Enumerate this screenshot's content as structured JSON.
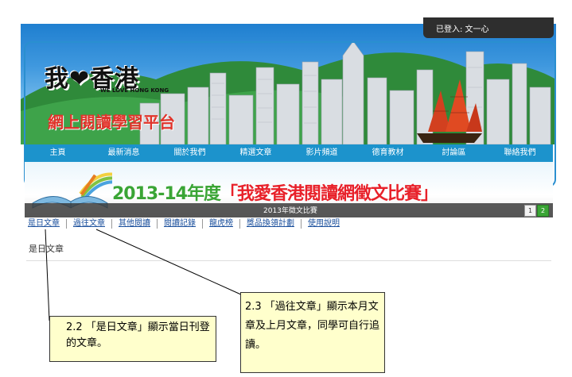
{
  "login": {
    "text": "已登入: 文一心"
  },
  "logo": {
    "main": "我❤香港",
    "sub": "WE LOVE HONG KONG",
    "platform": "網上閱讀學習平台"
  },
  "nav": {
    "items": [
      "主頁",
      "最新消息",
      "關於我們",
      "精選文章",
      "影片頻道",
      "德育教材",
      "討論區",
      "聯絡我們"
    ]
  },
  "contest": {
    "year": "2013-14年度",
    "title": "「我愛香港閱讀網徵文比賽」",
    "caption": "2013年徵文比賽",
    "pages": [
      "1",
      "2"
    ]
  },
  "subnav": {
    "items": [
      "是日文章",
      "過往文章",
      "其他閱讀",
      "閱讀記錄",
      "龍虎榜",
      "獎品換領計劃",
      "使用說明"
    ]
  },
  "section": {
    "title": "是日文章"
  },
  "callouts": {
    "c22": "2.2 「是日文章」顯示當日刊登的文章。",
    "c23": "2.3 「過往文章」顯示本月文章及上月文章，同學可自行追讀。"
  },
  "colors": {
    "nav": "#1c93cc",
    "accent_red": "#e8212a",
    "green": "#3aa535",
    "callout_bg": "#ffffcc"
  }
}
